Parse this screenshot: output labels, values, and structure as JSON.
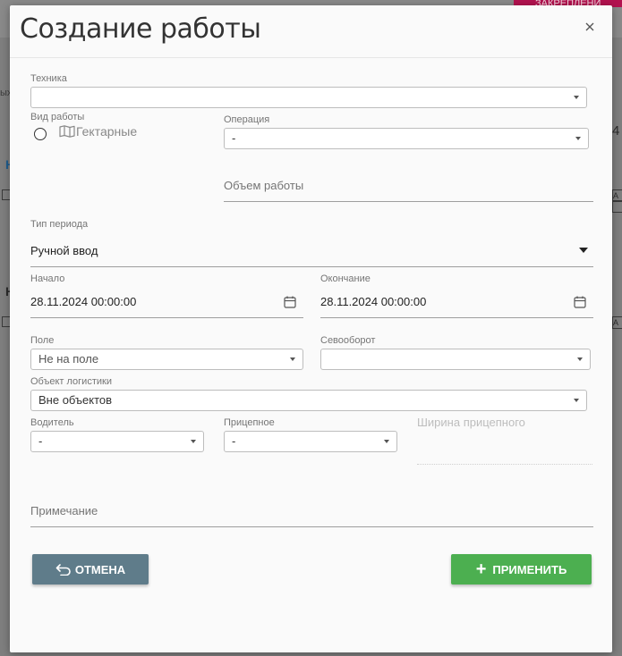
{
  "background": {
    "corner_badge": "ЗАКРЕПЛЕНИ",
    "left_fragment": "ых",
    "left_blue_letter": "Н",
    "left_dark_letter": "Н",
    "right_digit": "4",
    "right_box_letter": "А"
  },
  "modal": {
    "title": "Создание работы",
    "close_icon": "close-icon"
  },
  "form": {
    "tehnika": {
      "label": "Техника",
      "value": ""
    },
    "vid_raboty": {
      "label": "Вид работы",
      "option_label": "Гектарные",
      "selected": false
    },
    "operatsiya": {
      "label": "Операция",
      "value": "-"
    },
    "obem_raboty": {
      "placeholder": "Объем работы"
    },
    "tip_perioda": {
      "label": "Тип периода",
      "value": "Ручной ввод"
    },
    "nachalo": {
      "label": "Начало",
      "value": "28.11.2024 00:00:00"
    },
    "okonchanie": {
      "label": "Окончание",
      "value": "28.11.2024 00:00:00"
    },
    "pole": {
      "label": "Поле",
      "value": "Не на поле"
    },
    "sevooborot": {
      "label": "Севооборот",
      "value": ""
    },
    "obekt_logistiki": {
      "label": "Объект логистики",
      "value": "Вне объектов"
    },
    "voditel": {
      "label": "Водитель",
      "value": "-"
    },
    "pritsepnoe": {
      "label": "Прицепное",
      "value": "-"
    },
    "shirina_pritsepnogo": {
      "placeholder": "Ширина прицепного"
    },
    "primechanie": {
      "placeholder": "Примечание"
    }
  },
  "buttons": {
    "cancel_label": "ОТМЕНА",
    "apply_label": "ПРИМЕНИТЬ"
  },
  "colors": {
    "cancel_bg": "#5f7c8a",
    "apply_bg": "#4caf50",
    "badge": "#b3124f"
  }
}
